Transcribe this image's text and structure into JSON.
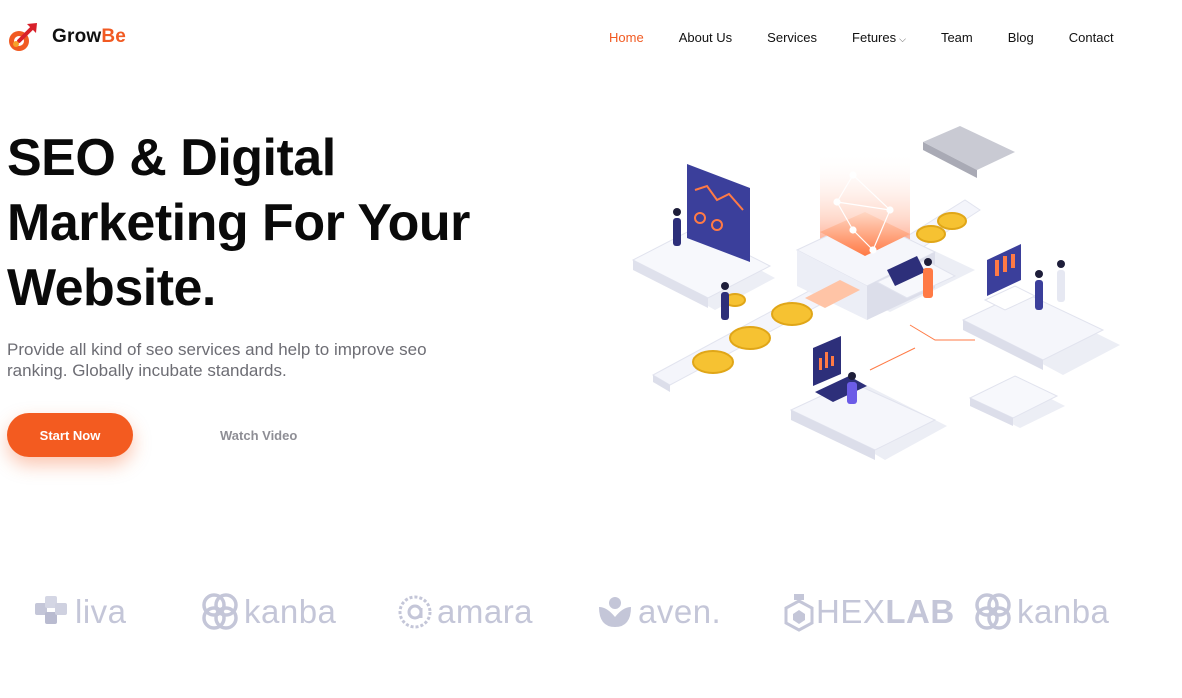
{
  "brand": {
    "name_part1": "Grow",
    "name_part2": "Be",
    "accent_color": "#f15a22"
  },
  "nav": {
    "items": [
      {
        "label": "Home",
        "active": true
      },
      {
        "label": "About Us"
      },
      {
        "label": "Services"
      },
      {
        "label": "Fetures",
        "dropdown": true
      },
      {
        "label": "Team"
      },
      {
        "label": "Blog"
      },
      {
        "label": "Contact"
      }
    ]
  },
  "hero": {
    "title_line1": "SEO & Digital",
    "title_line2": "Marketing For Your",
    "title_line3": "Website.",
    "description_line1": "Provide all kind of seo services and help to improve seo",
    "description_line2": "ranking. Globally incubate standards.",
    "primary_button": "Start Now",
    "secondary_button": "Watch Video",
    "button_color": "#f35b20",
    "illustration_icon": "isometric-seo-illustration"
  },
  "partners": {
    "logo_color": "#c4c6d8",
    "items": [
      {
        "name": "liva",
        "icon": "liva-icon"
      },
      {
        "name": "kanba",
        "icon": "kanba-icon"
      },
      {
        "name": "amara",
        "icon": "amara-icon"
      },
      {
        "name": "aven.",
        "icon": "aven-icon"
      },
      {
        "name_part1": "HEX",
        "name_part2": "LAB",
        "icon": "hexlab-icon"
      },
      {
        "name": "kanba",
        "icon": "kanba-icon"
      }
    ]
  }
}
